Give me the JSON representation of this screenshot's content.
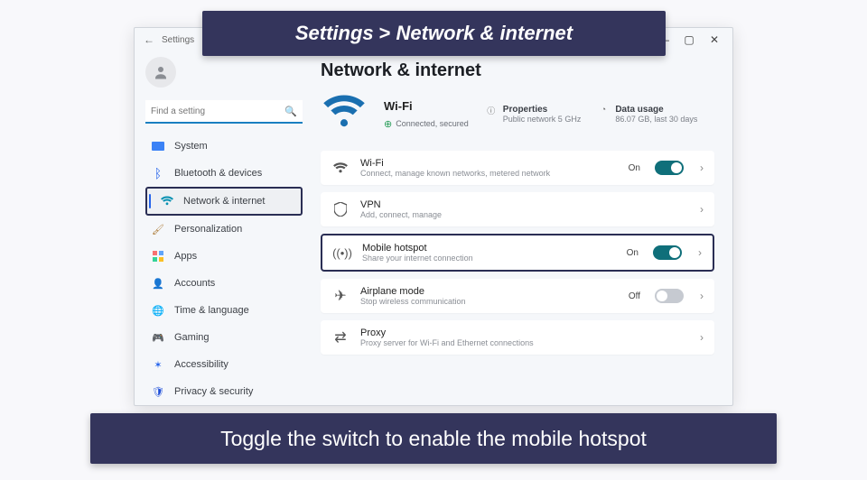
{
  "window": {
    "back": "←",
    "title": "Settings",
    "min": "—",
    "max": "▢",
    "close": "✕"
  },
  "search": {
    "placeholder": "Find a setting"
  },
  "nav": {
    "system": "System",
    "bluetooth": "Bluetooth & devices",
    "network": "Network & internet",
    "personalization": "Personalization",
    "apps": "Apps",
    "accounts": "Accounts",
    "time": "Time & language",
    "gaming": "Gaming",
    "accessibility": "Accessibility",
    "privacy": "Privacy & security"
  },
  "page": {
    "title": "Network & internet",
    "hero": {
      "title": "Wi-Fi",
      "status": "Connected, secured",
      "props_label": "Properties",
      "props_sub": "Public network 5 GHz",
      "data_label": "Data usage",
      "data_sub": "86.07 GB, last 30 days"
    },
    "cards": {
      "wifi": {
        "title": "Wi-Fi",
        "sub": "Connect, manage known networks, metered network",
        "state": "On"
      },
      "vpn": {
        "title": "VPN",
        "sub": "Add, connect, manage"
      },
      "hotspot": {
        "title": "Mobile hotspot",
        "sub": "Share your internet connection",
        "state": "On"
      },
      "airplane": {
        "title": "Airplane mode",
        "sub": "Stop wireless communication",
        "state": "Off"
      },
      "proxy": {
        "title": "Proxy",
        "sub": "Proxy server for Wi-Fi and Ethernet connections"
      }
    }
  },
  "callouts": {
    "top_a": "Settings",
    "top_gt": ">",
    "top_b": "Network & internet",
    "bottom": "Toggle the switch to enable the mobile hotspot"
  }
}
